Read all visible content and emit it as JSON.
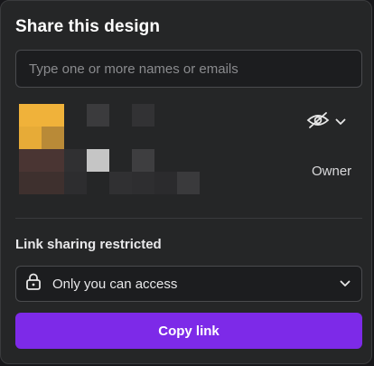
{
  "dialog": {
    "title": "Share this design"
  },
  "search": {
    "placeholder": "Type one or more names or emails",
    "value": ""
  },
  "member": {
    "role": "Owner",
    "visibility_icon": "eye-off-icon",
    "dropdown_icon": "chevron-down-icon"
  },
  "link_sharing": {
    "heading": "Link sharing restricted",
    "selected_option": "Only you can access",
    "icon": "lock-icon"
  },
  "actions": {
    "copy_link_label": "Copy link"
  },
  "colors": {
    "background": "#252627",
    "accent": "#7d2ae8",
    "text": "#ffffff"
  }
}
